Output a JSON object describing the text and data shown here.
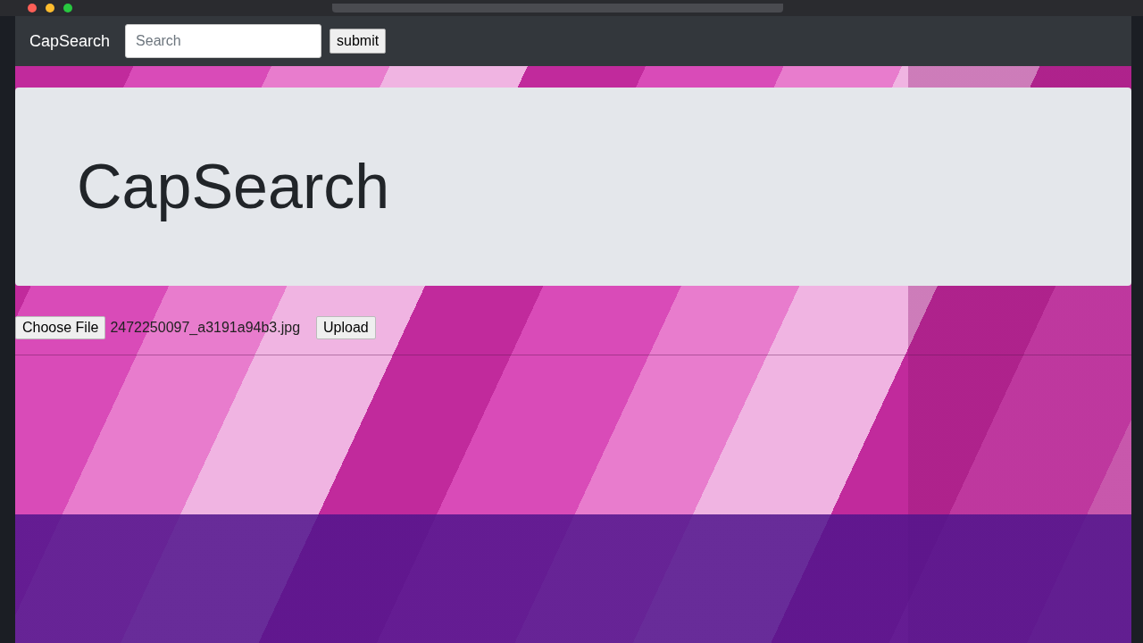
{
  "navbar": {
    "brand": "CapSearch",
    "search": {
      "placeholder": "Search"
    },
    "submit": "submit"
  },
  "jumbotron": {
    "title": "CapSearch"
  },
  "upload_form": {
    "choose_file": "Choose File",
    "file_name": "2472250097_a3191a94b3.jpg",
    "upload": "Upload"
  }
}
